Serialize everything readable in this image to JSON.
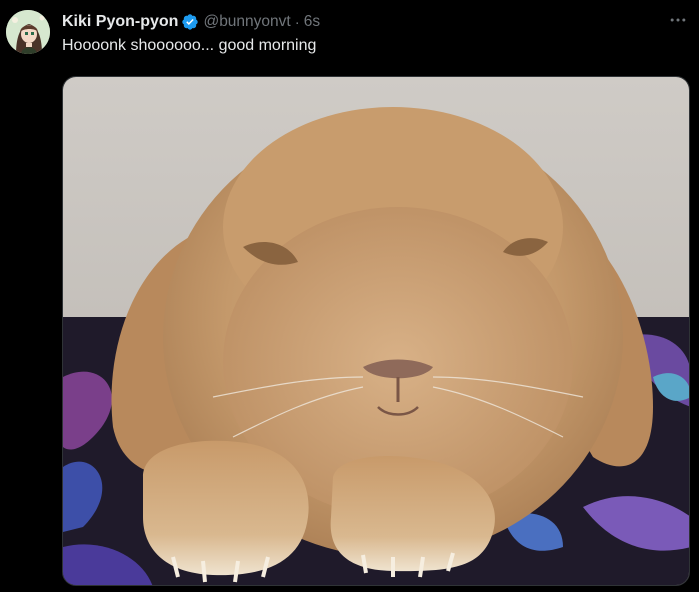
{
  "tweet": {
    "author": {
      "display_name": "Kiki Pyon-pyon",
      "handle": "@bunnyonvt",
      "verified": true,
      "avatar_icon": "anime-avatar"
    },
    "separator": "·",
    "timestamp": "6s",
    "text": "Hoooonk shoooooo... good morning",
    "more_icon": "more-horizontal-icon",
    "media_description_icon": "rabbit-photo"
  },
  "colors": {
    "background": "#000000",
    "primary_text": "#e7e9ea",
    "secondary_text": "#71767b",
    "verified_blue": "#1d9bf0",
    "border": "#2f3336"
  }
}
